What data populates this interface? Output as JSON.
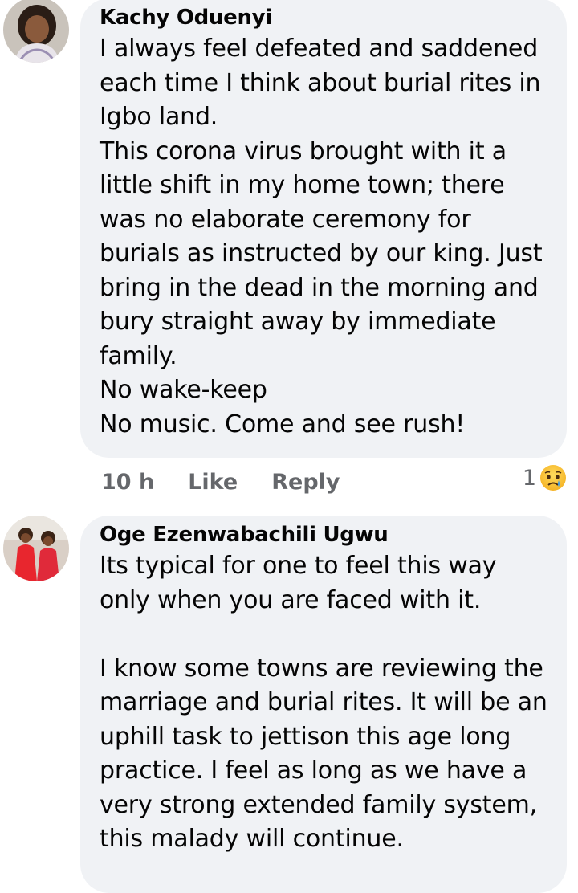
{
  "comments": [
    {
      "author": "Kachy Oduenyi",
      "text": "I always feel defeated and saddened\neach time I think about burial rites in\nIgbo land.\nThis corona virus brought with it a\nlittle shift in my home town; there\nwas no elaborate ceremony for\nburials as instructed by our king. Just\nbring in the dead in the morning and\nbury straight away by immediate\nfamily.\nNo wake-keep\nNo music. Come and see rush!",
      "time": "10 h",
      "like_label": "Like",
      "reply_label": "Reply",
      "reaction_count": "1",
      "reaction_icon": "sad-face-icon"
    },
    {
      "author": "Oge Ezenwabachili Ugwu",
      "text": "Its typical for one to feel this way\nonly when you are faced with it.\n\nI know some towns are reviewing the\nmarriage and burial rites. It will be an\nuphill task to jettison this age long\npractice. I feel as long as we have a\nvery strong extended family system,\nthis malady will continue."
    }
  ],
  "colors": {
    "bubble": "#f0f2f5",
    "text": "#050505",
    "secondary": "#65676b"
  }
}
